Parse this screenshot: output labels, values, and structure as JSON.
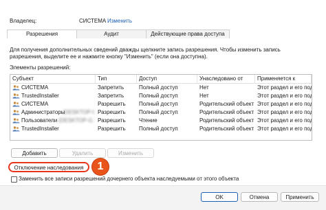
{
  "owner": {
    "label": "Владелец:",
    "value": "СИСТЕМА",
    "change_link": "Изменить"
  },
  "tabs": [
    {
      "label": "Разрешения"
    },
    {
      "label": "Аудит"
    },
    {
      "label": "Действующие права доступа"
    }
  ],
  "info_text": "Для получения дополнительных сведений дважды щелкните запись разрешения. Чтобы изменить запись разрешения, выделите ее и нажмите кнопку \"Изменить\" (если она доступна).",
  "entries_label": "Элементы разрешений:",
  "columns": [
    "Субъект",
    "Тип",
    "Доступ",
    "Унаследовано от",
    "Применяется к"
  ],
  "rows": [
    {
      "subject": "СИСТЕМА",
      "suffix": "",
      "type": "Запретить",
      "access": "Полный доступ",
      "inherited": "Нет",
      "applies": "Этот раздел и его подр"
    },
    {
      "subject": "TrustedInstaller",
      "suffix": "",
      "type": "Запретить",
      "access": "Полный доступ",
      "inherited": "Нет",
      "applies": "Этот раздел и его подр"
    },
    {
      "subject": "СИСТЕМА",
      "suffix": "",
      "type": "Разрешить",
      "access": "Полный доступ",
      "inherited": "Родительский объект",
      "applies": "Этот раздел и его подр"
    },
    {
      "subject": "Администраторы",
      "suffix": "(DESKTOP-G...",
      "type": "Разрешить",
      "access": "Полный доступ",
      "inherited": "Родительский объект",
      "applies": "Этот раздел и его подр"
    },
    {
      "subject": "Пользователи",
      "suffix": "(DESKTOP-G...",
      "type": "Разрешить",
      "access": "Чтение",
      "inherited": "Родительский объект",
      "applies": "Этот раздел и его подр"
    },
    {
      "subject": "TrustedInstaller",
      "suffix": "",
      "type": "Разрешить",
      "access": "Полный доступ",
      "inherited": "Родительский объект",
      "applies": "Этот раздел и его подр"
    }
  ],
  "buttons": {
    "add": "Добавить",
    "remove": "Удалить",
    "edit": "Изменить"
  },
  "disable_inheritance": "Отключение наследования",
  "step_badge": "1",
  "replace_checkbox_label": "Заменить все записи разрешений дочернего объекта наследуемыми от этого объекта",
  "footer": {
    "ok": "OK",
    "cancel": "Отмена",
    "apply": "Применить"
  },
  "colors": {
    "accent": "#1a5fb4",
    "badge": "#e8541a",
    "highlight": "#e8341a"
  }
}
